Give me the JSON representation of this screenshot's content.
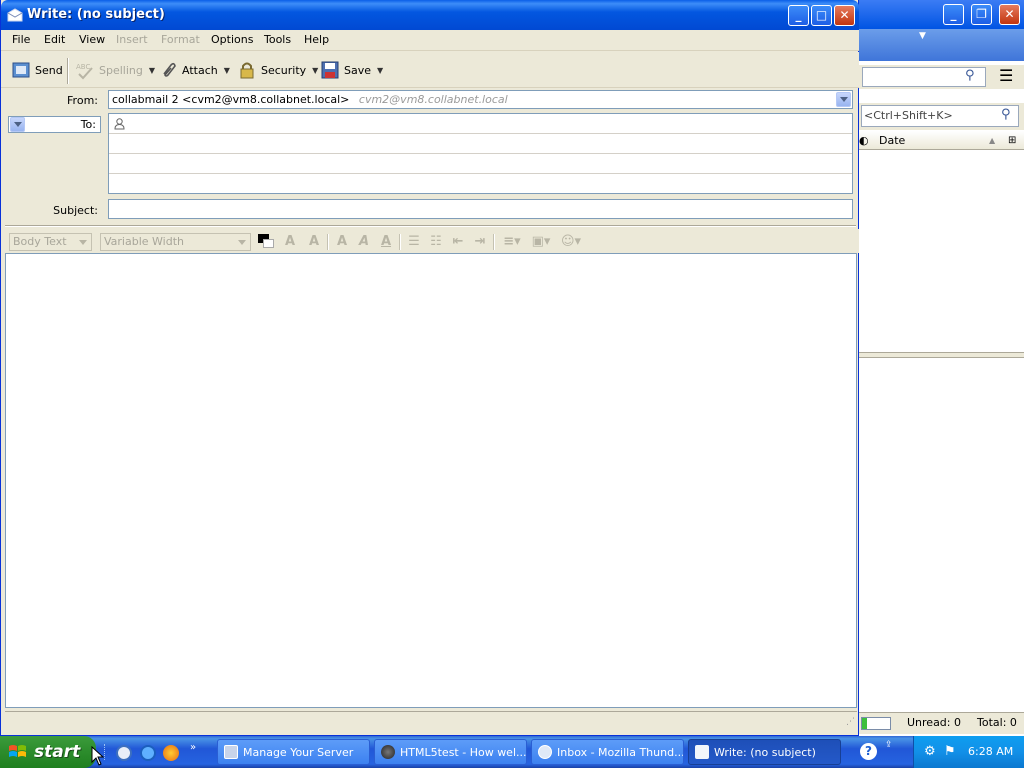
{
  "window": {
    "title": "Write: (no subject)"
  },
  "menu": [
    "File",
    "Edit",
    "View",
    "Insert",
    "Format",
    "Options",
    "Tools",
    "Help"
  ],
  "toolbar": {
    "send": "Send",
    "spelling": "Spelling",
    "attach": "Attach",
    "security": "Security",
    "save": "Save"
  },
  "header": {
    "from_label": "From:",
    "from_value": "collabmail 2 <cvm2@vm8.collabnet.local>",
    "from_hint": "cvm2@vm8.collabnet.local",
    "to_label": "To:",
    "subject_label": "Subject:",
    "subject_value": ""
  },
  "format": {
    "paragraph_style": "Body Text",
    "font": "Variable Width"
  },
  "background_window": {
    "quick_filter_placeholder": "<Ctrl+Shift+K>",
    "column_date": "Date",
    "unread": "Unread: 0",
    "total": "Total: 0"
  },
  "taskbar": {
    "start": "start",
    "tasks": [
      {
        "label": "Manage Your Server"
      },
      {
        "label": "HTML5test - How wel..."
      },
      {
        "label": "Inbox - Mozilla Thund..."
      },
      {
        "label": "Write: (no subject)"
      }
    ],
    "clock": "6:28 AM"
  }
}
